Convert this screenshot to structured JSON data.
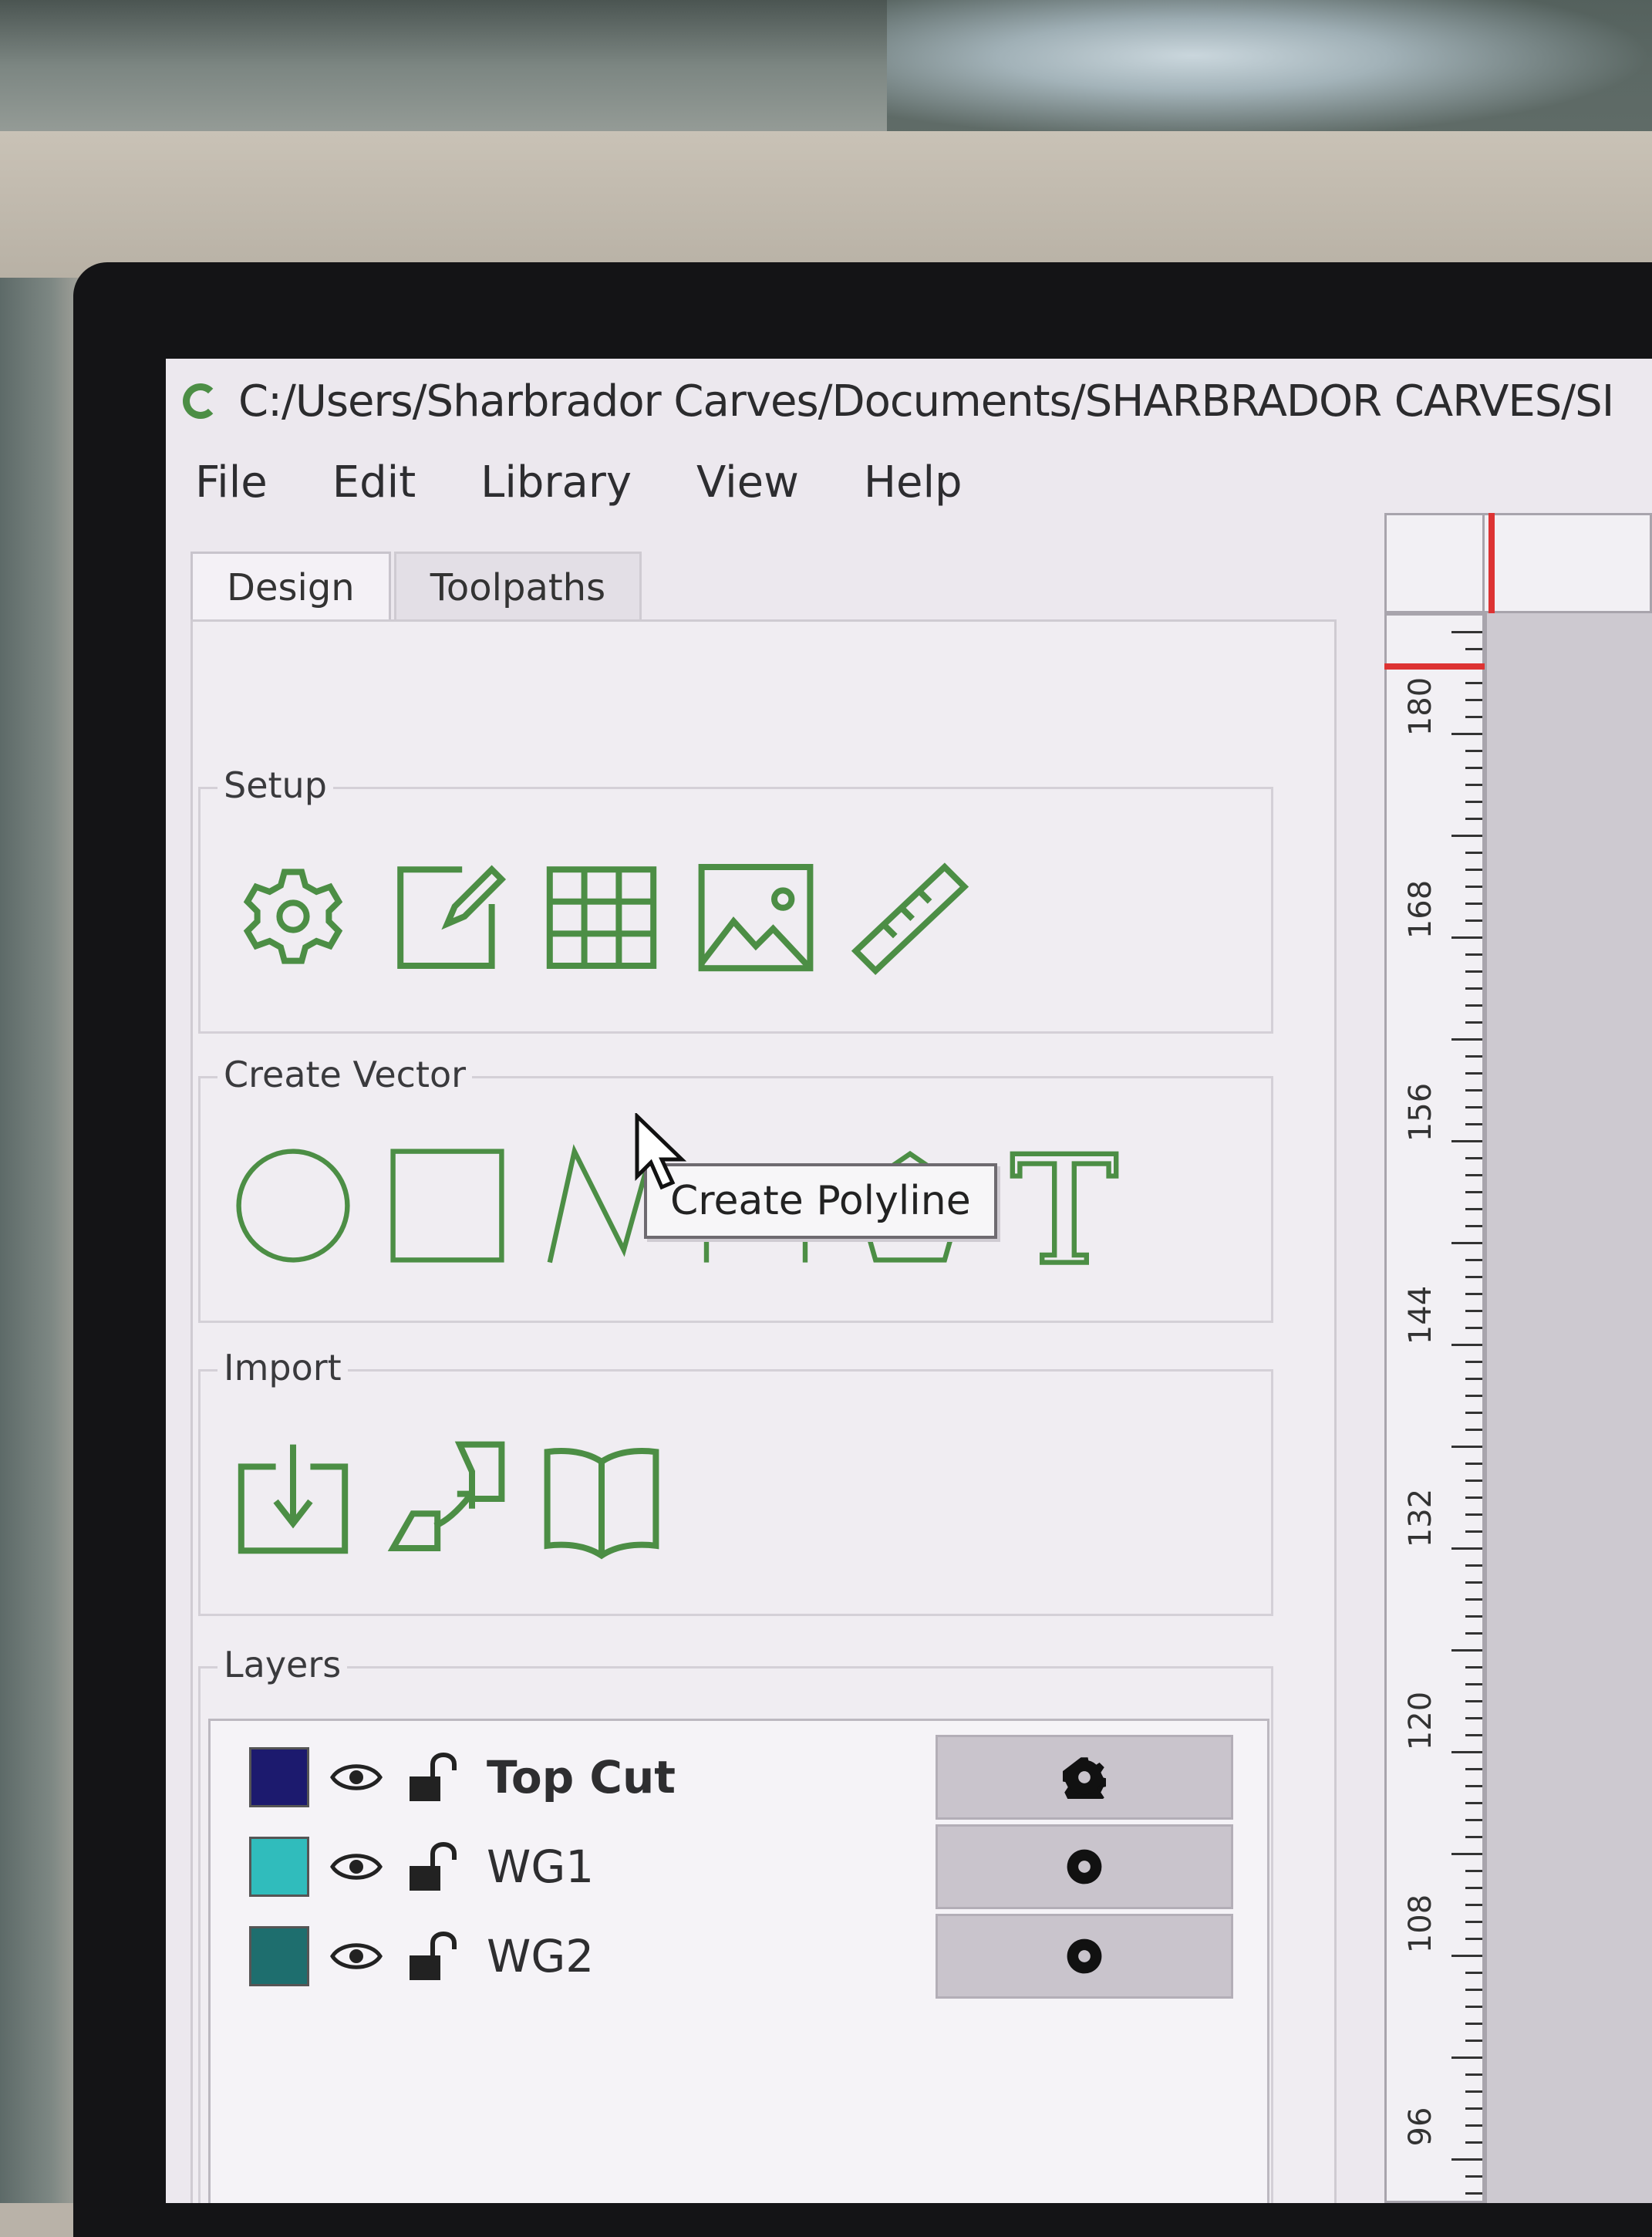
{
  "window": {
    "title": "C:/Users/Sharbrador Carves/Documents/SHARBRADOR CARVES/SI"
  },
  "menu": [
    "File",
    "Edit",
    "Library",
    "View",
    "Help"
  ],
  "tabs": [
    {
      "label": "Design",
      "active": true
    },
    {
      "label": "Toolpaths",
      "active": false
    }
  ],
  "panel": {
    "setup": {
      "title": "Setup",
      "tools": [
        "job-setup-gear-icon",
        "edit-job-icon",
        "grid-icon",
        "image-icon",
        "ruler-icon"
      ]
    },
    "create_vector": {
      "title": "Create Vector",
      "tools": [
        "circle-icon",
        "rectangle-icon",
        "polyline-icon",
        "arch-icon",
        "polygon-icon",
        "text-icon"
      ]
    },
    "import": {
      "title": "Import",
      "tools": [
        "import-icon",
        "import-components-icon",
        "library-book-icon"
      ]
    },
    "layers": {
      "title": "Layers",
      "items": [
        {
          "name": "Top Cut",
          "color": "#1c1a6e",
          "bold": true
        },
        {
          "name": "WG1",
          "color": "#30bcbc",
          "bold": false
        },
        {
          "name": "WG2",
          "color": "#1e6e6e",
          "bold": false
        }
      ]
    }
  },
  "tooltip": {
    "text": "Create Polyline"
  },
  "ruler": {
    "labels": [
      "180",
      "168",
      "156",
      "144",
      "132",
      "120",
      "108",
      "96"
    ]
  },
  "colors": {
    "icon_green": "#4c8e45",
    "ruler_marker": "#dd3333"
  }
}
